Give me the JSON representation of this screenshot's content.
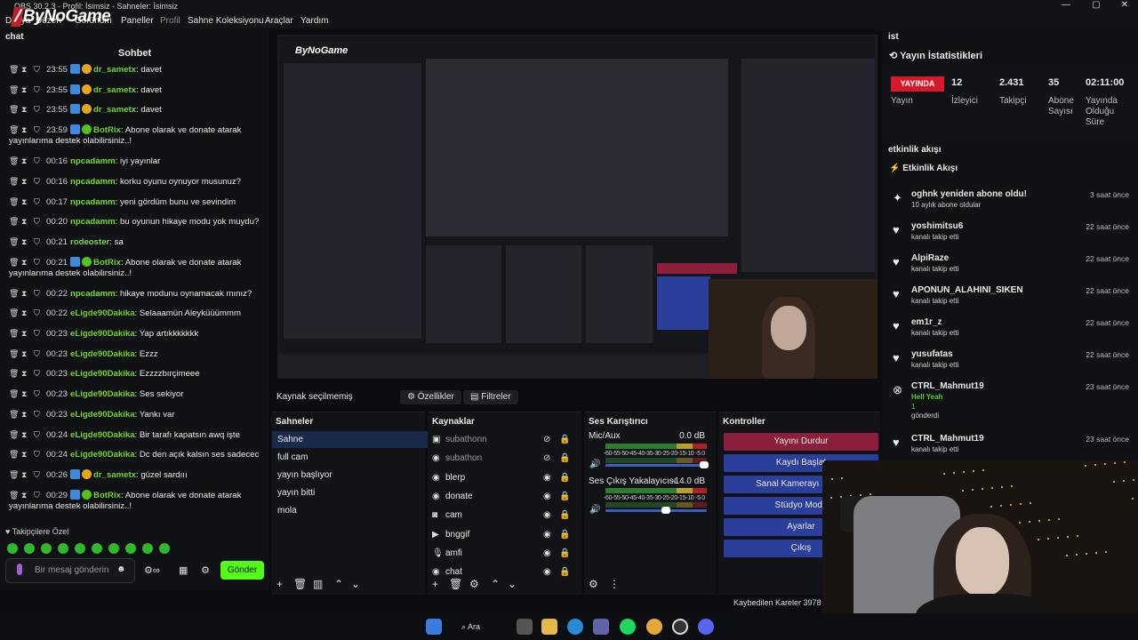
{
  "window": {
    "title": "OBS 30.2.3 - Profil: İsimsiz - Sahneler: İsimsiz",
    "logo": "ByNoGame"
  },
  "menu": [
    "Dosya",
    "Düzen",
    "Görünüm",
    "Paneller",
    "Profil",
    "Sahne Koleksiyonu",
    "Araçlar",
    "Yardım"
  ],
  "chat": {
    "dock_title": "chat",
    "header": "Sohbet",
    "messages": [
      {
        "time": "23:55",
        "user": "dr_sametx",
        "text": ": davet",
        "badges": [
          "blue",
          "gold"
        ]
      },
      {
        "time": "23:55",
        "user": "dr_sametx",
        "text": ": davet",
        "badges": [
          "blue",
          "gold"
        ]
      },
      {
        "time": "23:55",
        "user": "dr_sametx",
        "text": ": davet",
        "badges": [
          "blue",
          "gold"
        ]
      },
      {
        "time": "23:59",
        "user": "BotRix",
        "text": ": Abone olarak ve donate atarak",
        "text2": "yayınlarıma destek olabilirsiniz..!",
        "badges": [
          "blue",
          "green"
        ]
      },
      {
        "time": "00:16",
        "user": "npcadamm",
        "text": ": iyi yayınlar",
        "badges": []
      },
      {
        "time": "00:16",
        "user": "npcadamm",
        "text": ": korku oyunu oynuyor musunuz?",
        "badges": []
      },
      {
        "time": "00:17",
        "user": "npcadamm",
        "text": ": yeni gördüm bunu ve sevindim",
        "badges": []
      },
      {
        "time": "00:20",
        "user": "npcadamm",
        "text": ": bu oyunun hikaye modu yok muydu?",
        "badges": []
      },
      {
        "time": "00:21",
        "user": "rodeoster",
        "text": ": sa",
        "badges": []
      },
      {
        "time": "00:21",
        "user": "BotRix",
        "text": ": Abone olarak ve donate atarak",
        "text2": "yayınlarıma destek olabilirsiniz..!",
        "badges": [
          "blue",
          "green"
        ]
      },
      {
        "time": "00:22",
        "user": "npcadamm",
        "text": ": hikaye modunu oynamacak mınız?",
        "badges": []
      },
      {
        "time": "00:22",
        "user": "eLigde90Dakika",
        "text": ": Selaaamün Aleyküüümmm",
        "badges": []
      },
      {
        "time": "00:23",
        "user": "eLigde90Dakika",
        "text": ": Yap artıkkkkkkk",
        "badges": []
      },
      {
        "time": "00:23",
        "user": "eLigde90Dakika",
        "text": ": Ezzz",
        "badges": []
      },
      {
        "time": "00:23",
        "user": "eLigde90Dakika",
        "text": ": Ezzzzbırçimeee",
        "badges": []
      },
      {
        "time": "00:23",
        "user": "eLigde90Dakika",
        "text": ": Ses sekiyor",
        "badges": []
      },
      {
        "time": "00:23",
        "user": "eLigde90Dakika",
        "text": ": Yankı var",
        "badges": []
      },
      {
        "time": "00:24",
        "user": "eLigde90Dakika",
        "text": ": Bir tarafı kapatsın awq işte",
        "badges": []
      },
      {
        "time": "00:24",
        "user": "eLigde90Dakika",
        "text": ": Dc den açık kalsın ses sadecec",
        "badges": []
      },
      {
        "time": "00:26",
        "user": "dr_sametx",
        "text": ": güzel sardııı",
        "badges": [
          "blue",
          "gold"
        ]
      },
      {
        "time": "00:29",
        "user": "BotRix",
        "text": ": Abone olarak ve donate atarak",
        "text2": "yayınlarıma destek olabilirsiniz..!",
        "badges": [
          "blue",
          "green"
        ]
      }
    ],
    "followers_only": "Takipçilere Özel",
    "input_placeholder": "Bir mesaj gönderin",
    "send_label": "Gönder"
  },
  "source_bar": {
    "label": "Kaynak seçilmemiş",
    "properties": "Özellikler",
    "filters": "Filtreler"
  },
  "scenes": {
    "title": "Sahneler",
    "items": [
      "Sahne",
      "full cam",
      "yayın başlıyor",
      "yayın bitti",
      "mola"
    ],
    "selected": 0
  },
  "sources": {
    "title": "Kaynaklar",
    "items": [
      {
        "name": "subathonn",
        "icon": "pip-icon",
        "visible": false,
        "locked": true
      },
      {
        "name": "subathon",
        "icon": "browser-icon",
        "visible": false,
        "locked": true
      },
      {
        "name": "blerp",
        "icon": "browser-icon",
        "visible": true,
        "locked": true
      },
      {
        "name": "donate",
        "icon": "browser-icon",
        "visible": true,
        "locked": true
      },
      {
        "name": "cam",
        "icon": "camera-icon",
        "visible": true,
        "locked": true
      },
      {
        "name": "bnggif",
        "icon": "media-icon",
        "visible": true,
        "locked": false
      },
      {
        "name": "amfi",
        "icon": "mic-icon",
        "visible": true,
        "locked": false
      },
      {
        "name": "chat",
        "icon": "browser-icon",
        "visible": true,
        "locked": true
      }
    ]
  },
  "mixer": {
    "title": "Ses Karıştırıcı",
    "channels": [
      {
        "name": "Mic/Aux",
        "db": "0.0 dB",
        "level": 1.0
      },
      {
        "name": "Ses Çıkış Yakalayıcısı",
        "db": "-14.0 dB",
        "level": 0.62
      }
    ],
    "ticks": "-60-55-50-45-40-35-30-25-20-15-10 -5  0"
  },
  "controls": {
    "title": "Kontroller",
    "buttons": [
      "Yayını Durdur",
      "Kaydı Başlat",
      "Sanal Kamerayı Başlat",
      "Stüdyo Modu",
      "Ayarlar",
      "Çıkış"
    ]
  },
  "right_dock": {
    "dock_title": "ist",
    "stats_title": "Yayın İstatistikleri",
    "live_badge": "YAYINDA",
    "stats": [
      {
        "value": "12",
        "label": "İzleyici"
      },
      {
        "value": "2.431",
        "label": "Takipçi"
      },
      {
        "value": "35",
        "label": "Abone Sayısı"
      },
      {
        "value": "02:11:00",
        "label": "Yayında Olduğu Süre"
      }
    ],
    "live_label": "Yayın",
    "events_dock": "etkinlik akışı",
    "events_title": "Etkinlik Akışı",
    "events": [
      {
        "name": "oghnk yeniden abone oldu!",
        "sub": "10 aylık abone oldular",
        "time": "3 saat önce",
        "icon": "sparkle-icon"
      },
      {
        "name": "yoshimitsu6",
        "sub": "kanalı takip etti",
        "time": "22 saat önce",
        "icon": "heart-icon"
      },
      {
        "name": "AlpiRaze",
        "sub": "kanalı takip etti",
        "time": "22 saat önce",
        "icon": "heart-icon"
      },
      {
        "name": "APONUN_ALAHINI_SIKEN",
        "sub": "kanalı takip etti",
        "time": "22 saat önce",
        "icon": "heart-icon"
      },
      {
        "name": "em1r_z",
        "sub": "kanalı takip etti",
        "time": "22 saat önce",
        "icon": "heart-icon"
      },
      {
        "name": "yusufatas",
        "sub": "kanalı takip etti",
        "time": "22 saat önce",
        "icon": "heart-icon"
      },
      {
        "name": "CTRL_Mahmut19",
        "sub": "Hell Yeah",
        "sub2": "1",
        "sub3": "gönderdi",
        "time": "23 saat önce",
        "icon": "kick-icon"
      },
      {
        "name": "CTRL_Mahmut19",
        "sub": "kanalı takip etti",
        "time": "23 saat önce",
        "icon": "heart-icon"
      }
    ]
  },
  "status": {
    "dropped_frames": "Kaybedilen Kareler 3978"
  },
  "taskbar": {
    "search": "Ara"
  },
  "colors": {
    "accent_green": "#53fc18",
    "live_red": "#d8182a",
    "control_red": "#8a1e3b",
    "control_blue": "#2a3f9c"
  }
}
